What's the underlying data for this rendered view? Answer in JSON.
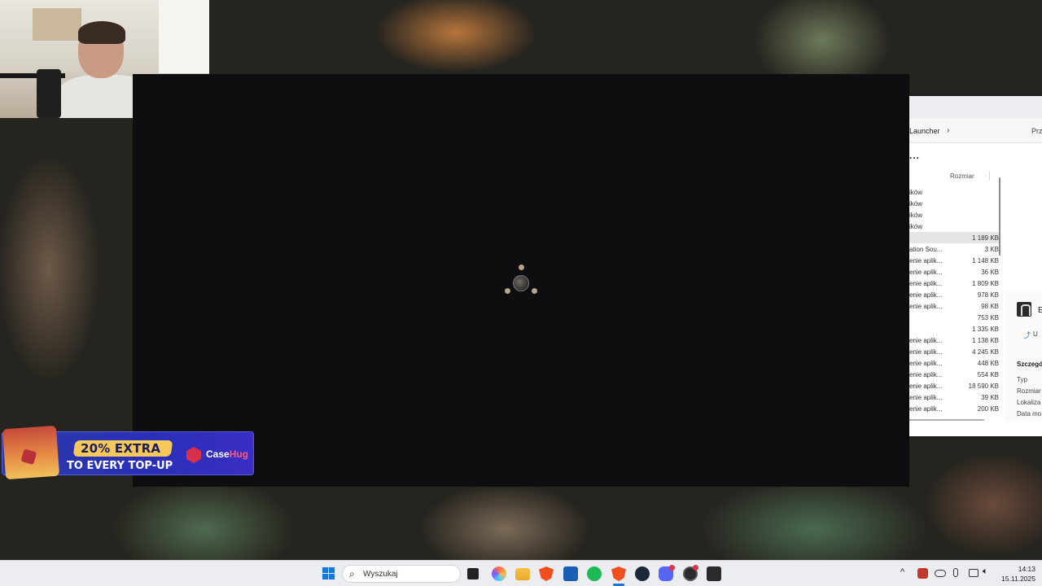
{
  "explorer": {
    "breadcrumb": "Launcher",
    "address_right": "Prz",
    "more_label": "...",
    "column_size": "Rozmiar",
    "rows": [
      {
        "type": "ików",
        "size": ""
      },
      {
        "type": "ików",
        "size": ""
      },
      {
        "type": "ików",
        "size": ""
      },
      {
        "type": "ików",
        "size": ""
      },
      {
        "type": "",
        "size": "1 189 KB",
        "selected": true
      },
      {
        "type": "ation Sou...",
        "size": "3 KB"
      },
      {
        "type": "enie aplik...",
        "size": "1 148 KB"
      },
      {
        "type": "enie aplik...",
        "size": "36 KB"
      },
      {
        "type": "enie aplik...",
        "size": "1 809 KB"
      },
      {
        "type": "enie aplik...",
        "size": "978 KB"
      },
      {
        "type": "enie aplik...",
        "size": "98 KB"
      },
      {
        "type": "",
        "size": "753 KB"
      },
      {
        "type": "",
        "size": "1 335 KB"
      },
      {
        "type": "enie aplik...",
        "size": "1 138 KB"
      },
      {
        "type": "enie aplik...",
        "size": "4 245 KB"
      },
      {
        "type": "enie aplik...",
        "size": "448 KB"
      },
      {
        "type": "enie aplik...",
        "size": "554 KB"
      },
      {
        "type": "enie aplik...",
        "size": "18 590 KB"
      },
      {
        "type": "enie aplik...",
        "size": "39 KB"
      },
      {
        "type": "enie aplik...",
        "size": "200 KB"
      }
    ],
    "details": {
      "app_name": "E",
      "share_label": "U",
      "title": "Szczegół",
      "props": [
        "Typ",
        "Rozmiar",
        "Lokaliza",
        "Data mo"
      ]
    }
  },
  "ad": {
    "headline": "20% EXTRA",
    "subline": "TO EVERY TOP-UP",
    "brand_a": "Case",
    "brand_b": "Hug"
  },
  "taskbar": {
    "search_placeholder": "Wyszukaj",
    "icons": [
      "start-icon",
      "search-icon",
      "task-view-icon",
      "copilot-icon",
      "file-explorer-icon",
      "brave-icon",
      "microsoft-store-icon",
      "spotify-icon",
      "brave-icon",
      "steam-icon",
      "discord-icon",
      "obs-icon",
      "app-a-icon"
    ],
    "tray_chevron": "^",
    "time": "14:13",
    "date": "15.11.2025"
  },
  "colors": {
    "taskbar_bg": "#ebedf1",
    "loader_bg": "#0e0d10",
    "spinner_dot": "#b3a58a",
    "ad_bg": "#2a2fb8",
    "ad_pill": "#f4c85a",
    "brand_accent": "#ff5a7a"
  }
}
